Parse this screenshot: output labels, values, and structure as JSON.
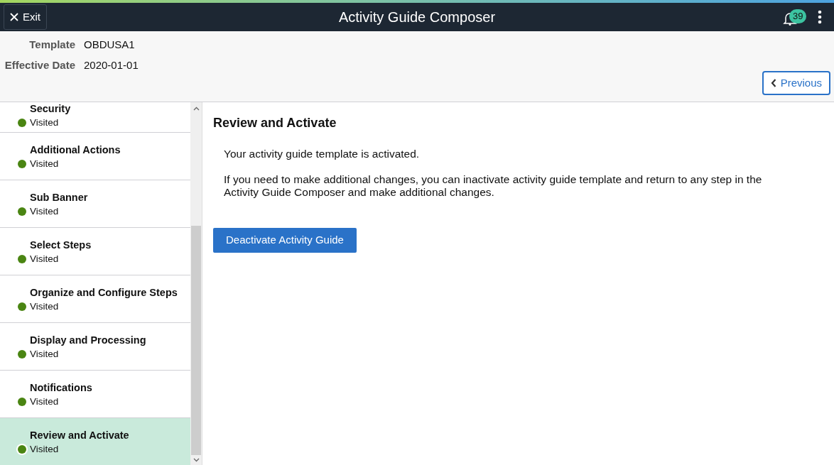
{
  "header": {
    "exit_label": "Exit",
    "title": "Activity Guide Composer",
    "notification_count": "39"
  },
  "info": [
    {
      "label": "Template",
      "value": "OBDUSA1"
    },
    {
      "label": "Effective Date",
      "value": "2020-01-01"
    }
  ],
  "previous_label": "Previous",
  "steps": [
    {
      "title": "Security",
      "status": "Visited",
      "selected": false
    },
    {
      "title": "Additional Actions",
      "status": "Visited",
      "selected": false
    },
    {
      "title": "Sub Banner",
      "status": "Visited",
      "selected": false
    },
    {
      "title": "Select Steps",
      "status": "Visited",
      "selected": false
    },
    {
      "title": "Organize and Configure Steps",
      "status": "Visited",
      "selected": false
    },
    {
      "title": "Display and Processing",
      "status": "Visited",
      "selected": false
    },
    {
      "title": "Notifications",
      "status": "Visited",
      "selected": false
    },
    {
      "title": "Review and Activate",
      "status": "Visited",
      "selected": true
    }
  ],
  "content": {
    "heading": "Review and Activate",
    "paragraphs": [
      "Your activity guide template is activated.",
      "If you need to make additional changes, you can inactivate activity guide template and return to any step in the Activity Guide Composer and make additional changes."
    ],
    "button": "Deactivate Activity Guide"
  }
}
